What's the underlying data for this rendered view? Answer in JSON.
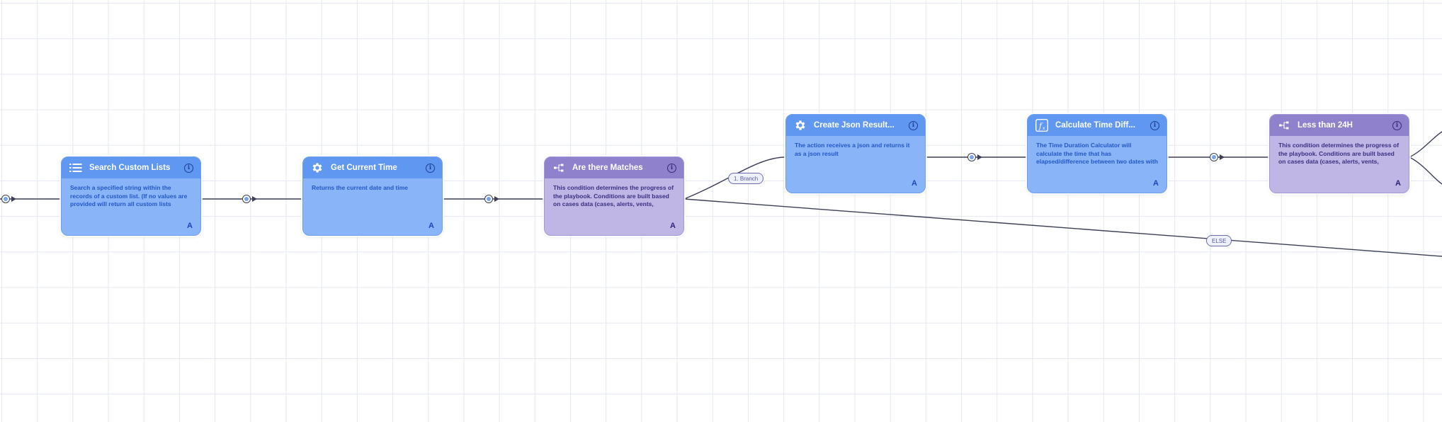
{
  "nodes": [
    {
      "id": "search-custom-lists",
      "type": "action",
      "icon": "list-icon",
      "title": "Search Custom Lists",
      "description": "Search a specified string within the records of a custom list. (If no values are provided will return all custom lists records)",
      "badge": "A"
    },
    {
      "id": "get-current-time",
      "type": "action",
      "icon": "gear-icon",
      "title": "Get Current Time",
      "description": "Returns the current date and time",
      "badge": "A"
    },
    {
      "id": "are-there-matches",
      "type": "condition",
      "icon": "branch-icon",
      "title": "Are there Matches",
      "description": "This condition determines the progress of the playbook. Conditions are built based on cases data (cases, alerts, vents, entities a...",
      "badge": "A"
    },
    {
      "id": "create-json-result",
      "type": "action",
      "icon": "gear-icon",
      "title": "Create Json Result...",
      "description": "The action receives a json and returns it as a json result",
      "badge": "A"
    },
    {
      "id": "calculate-time-diff",
      "type": "action",
      "icon": "function-icon",
      "title": "Calculate Time Diff...",
      "description": "The Time Duration Calculator will calculate the time that has elapsed/difference between two dates with time.",
      "badge": "A"
    },
    {
      "id": "less-than-24h",
      "type": "condition",
      "icon": "branch-icon",
      "title": "Less than 24H",
      "description": "This condition determines the progress of the playbook. Conditions are built based on cases data (cases, alerts, vents, entities a...",
      "badge": "A"
    }
  ],
  "branch_labels": {
    "branch_1": "1. Branch",
    "else": "ELSE"
  },
  "colors": {
    "action_body": "#8ab4f8",
    "action_header": "#5f97f1",
    "condition_body": "#bfb6e6",
    "condition_header": "#8f81cc",
    "connector": "#3c3f55",
    "grid": "#e4e8f1"
  }
}
